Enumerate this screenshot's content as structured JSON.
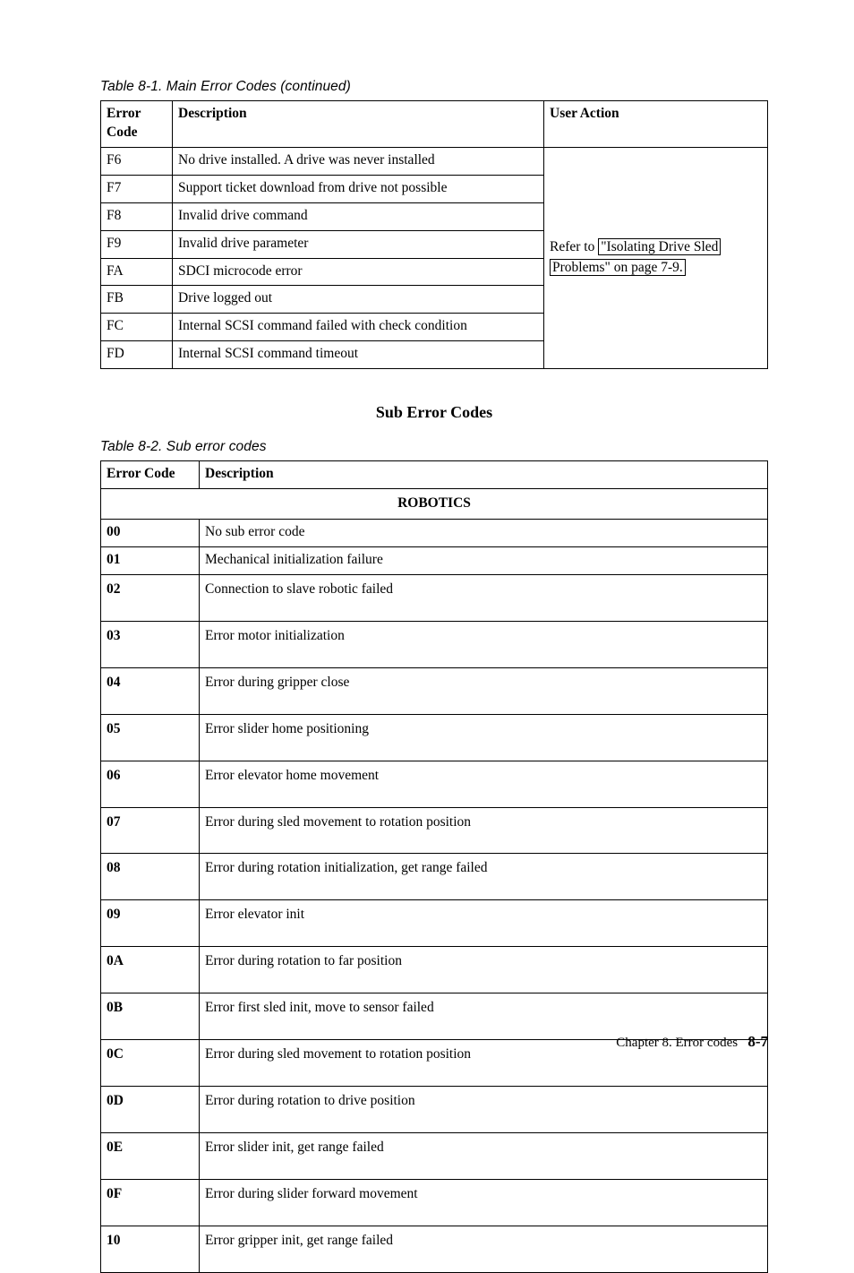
{
  "table1": {
    "caption": "Table 8-1. Main Error Codes  (continued)",
    "headers": {
      "col1": "Error Code",
      "col2": "Description",
      "col3": "User Action"
    },
    "rows": [
      {
        "code": "F6",
        "desc": "No drive installed. A drive was never installed"
      },
      {
        "code": "F7",
        "desc": "Support ticket download from drive not possible"
      },
      {
        "code": "F8",
        "desc": "Invalid drive command"
      },
      {
        "code": "F9",
        "desc": "Invalid drive parameter"
      },
      {
        "code": "FA",
        "desc": "SDCI microcode error"
      },
      {
        "code": "FB",
        "desc": "Drive logged out"
      },
      {
        "code": "FC",
        "desc": "Internal SCSI command failed with check condition"
      },
      {
        "code": "FD",
        "desc": "Internal SCSI command timeout"
      }
    ],
    "action": {
      "prefix": "Refer to ",
      "box1": "\"Isolating Drive Sled",
      "box2": "Problems\" on page 7-9."
    }
  },
  "subheading": "Sub Error Codes",
  "table2": {
    "caption": "Table 8-2. Sub error codes",
    "headers": {
      "col1": "Error Code",
      "col2": "Description"
    },
    "section_label": "ROBOTICS",
    "rows": [
      {
        "code": "00",
        "desc": "No sub error code"
      },
      {
        "code": "01",
        "desc": "Mechanical initialization failure"
      },
      {
        "code": "02",
        "desc": "Connection to slave robotic failed"
      },
      {
        "code": "03",
        "desc": "Error motor initialization"
      },
      {
        "code": "04",
        "desc": "Error during gripper close"
      },
      {
        "code": "05",
        "desc": "Error slider home positioning"
      },
      {
        "code": "06",
        "desc": "Error elevator home movement"
      },
      {
        "code": "07",
        "desc": "Error during sled movement to rotation position"
      },
      {
        "code": "08",
        "desc": "Error during rotation initialization, get range failed"
      },
      {
        "code": "09",
        "desc": "Error elevator init"
      },
      {
        "code": "0A",
        "desc": "Error during rotation to far position"
      },
      {
        "code": "0B",
        "desc": "Error first sled init, move to sensor failed"
      },
      {
        "code": "0C",
        "desc": "Error during sled movement to rotation position"
      },
      {
        "code": "0D",
        "desc": "Error during rotation to drive position"
      },
      {
        "code": "0E",
        "desc": "Error slider init, get range failed"
      },
      {
        "code": "0F",
        "desc": "Error during slider forward movement"
      },
      {
        "code": "10",
        "desc": "Error gripper init, get range failed"
      }
    ]
  },
  "footer": {
    "chapter": "Chapter 8. Error codes",
    "page": "8-7"
  }
}
